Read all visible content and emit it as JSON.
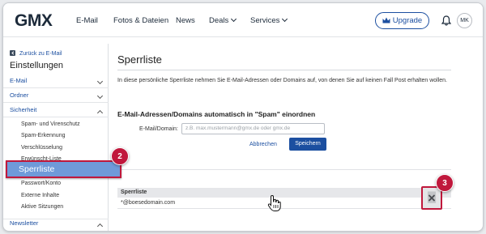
{
  "header": {
    "logo": "GMX",
    "nav": [
      "E-Mail",
      "Fotos & Dateien",
      "News",
      "Deals",
      "Services"
    ],
    "upgrade_label": "Upgrade",
    "avatar_initials": "MK"
  },
  "sidebar": {
    "back_label": "Zurück zu E-Mail",
    "title": "Einstellungen",
    "sections": [
      {
        "label": "E-Mail",
        "expanded": false
      },
      {
        "label": "Ordner",
        "expanded": false
      },
      {
        "label": "Sicherheit",
        "expanded": true
      },
      {
        "label": "Newsletter",
        "expanded": true
      }
    ],
    "security_items": [
      "Spam- und Virenschutz",
      "Spam-Erkennung",
      "Verschlüsselung",
      "Erwünscht-Liste",
      "Sperrliste",
      "Passwort/Konto",
      "Externe Inhalte",
      "Aktive Sitzungen"
    ],
    "active_item": "Sperrliste"
  },
  "main": {
    "title": "Sperrliste",
    "intro": "In diese persönliche Sperrliste nehmen Sie E-Mail-Adressen oder Domains auf, von denen Sie auf keinen Fall Post erhalten wollen.",
    "form_heading": "E-Mail-Adressen/Domains automatisch in \"Spam\" einordnen",
    "field_label": "E-Mail/Domain:",
    "field_placeholder": "z.B. max.mustermann@gmx.de oder gmx.de",
    "cancel_label": "Abbrechen",
    "save_label": "Speichern",
    "table_header": "Sperrliste",
    "rows": [
      "*@boesedomain.com"
    ]
  },
  "markers": [
    "2",
    "3"
  ],
  "colors": {
    "accent": "#1c4fa0",
    "marker": "#c0183c",
    "highlight": "#6f9ad9"
  }
}
